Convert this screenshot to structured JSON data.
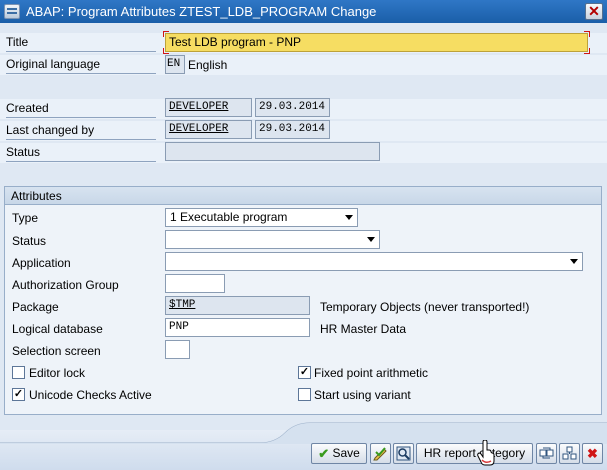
{
  "window": {
    "title": "ABAP: Program Attributes ZTEST_LDB_PROGRAM Change",
    "close_glyph": "✕"
  },
  "header": {
    "title_label": "Title",
    "title_value": "Test LDB program - PNP",
    "orig_lang_label": "Original language",
    "orig_lang_code": "EN",
    "orig_lang_name": "English",
    "created_label": "Created",
    "created_user": "DEVELOPER",
    "created_date": "29.03.2014",
    "changed_label": "Last changed by",
    "changed_user": "DEVELOPER",
    "changed_date": "29.03.2014",
    "status_label": "Status",
    "status_value": ""
  },
  "attributes": {
    "group_title": "Attributes",
    "type_label": "Type",
    "type_value": "1 Executable program",
    "status_label": "Status",
    "status_value": "",
    "application_label": "Application",
    "application_value": "",
    "auth_group_label": "Authorization Group",
    "auth_group_value": "",
    "package_label": "Package",
    "package_value": "$TMP",
    "package_desc": "Temporary Objects (never transported!)",
    "ldb_label": "Logical database",
    "ldb_value": "PNP",
    "ldb_desc": "HR Master Data",
    "sel_screen_label": "Selection screen",
    "sel_screen_value": "",
    "editor_lock_label": "Editor lock",
    "editor_lock_checked": false,
    "fixed_point_label": "Fixed point arithmetic",
    "fixed_point_checked": true,
    "unicode_label": "Unicode Checks Active",
    "unicode_checked": true,
    "start_variant_label": "Start using variant",
    "start_variant_checked": false
  },
  "toolbar": {
    "save_label": "Save",
    "hr_report_label": "HR report category",
    "check_glyph": "✔",
    "cancel_glyph": "✖"
  },
  "colors": {
    "title_bar": "#1f64b0",
    "required_field": "#f6dd62",
    "background": "#dfe8f3",
    "save_check": "#3a9b1e",
    "cancel_x": "#d01515"
  }
}
